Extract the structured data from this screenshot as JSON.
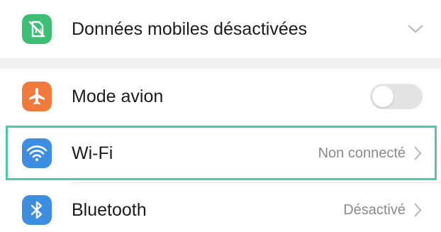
{
  "settings": {
    "mobile_data": {
      "label": "Données mobiles désactivées",
      "icon": "mobile-data-off-icon",
      "icon_color": "#3cbf74"
    },
    "airplane": {
      "label": "Mode avion",
      "icon": "airplane-icon",
      "icon_color": "#f07a3c",
      "enabled": false
    },
    "wifi": {
      "label": "Wi-Fi",
      "status": "Non connecté",
      "icon": "wifi-icon",
      "icon_color": "#3d8ee0"
    },
    "bluetooth": {
      "label": "Bluetooth",
      "status": "Désactivé",
      "icon": "bluetooth-icon",
      "icon_color": "#3d8ee0"
    }
  },
  "highlight_color": "#4fc8a8"
}
